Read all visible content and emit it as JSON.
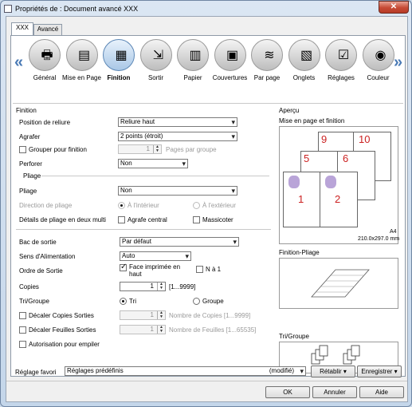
{
  "window": {
    "title": "Propriétés de : Document avancé XXX",
    "close": "✕"
  },
  "tabs": [
    {
      "label": "XXX"
    },
    {
      "label": "Avancé"
    }
  ],
  "categories": [
    {
      "label": "Général",
      "icon": "printer-icon",
      "glyph": "🖶"
    },
    {
      "label": "Mise en Page",
      "icon": "layout-icon",
      "glyph": "▤"
    },
    {
      "label": "Finition",
      "icon": "finishing-icon",
      "glyph": "▦"
    },
    {
      "label": "Sortir",
      "icon": "output-icon",
      "glyph": "⇲"
    },
    {
      "label": "Papier",
      "icon": "paper-icon",
      "glyph": "▥"
    },
    {
      "label": "Couvertures",
      "icon": "cover-icon",
      "glyph": "▣"
    },
    {
      "label": "Par page",
      "icon": "per-page-icon",
      "glyph": "≋"
    },
    {
      "label": "Onglets",
      "icon": "tabs-icon",
      "glyph": "▧"
    },
    {
      "label": "Réglages",
      "icon": "settings-icon",
      "glyph": "☑"
    },
    {
      "label": "Couleur",
      "icon": "color-icon",
      "glyph": "◉"
    }
  ],
  "nav": {
    "left": "«",
    "right": "»"
  },
  "finition": {
    "group_title": "Finition",
    "position_reliure_label": "Position de reliure",
    "position_reliure_value": "Reliure haut",
    "agrafer_label": "Agrafer",
    "agrafer_value": "2 points (étroit)",
    "grouper_label": "Grouper pour finition",
    "grouper_value": "1",
    "pages_par_groupe": "Pages par groupe",
    "perforer_label": "Perforer",
    "perforer_value": "Non"
  },
  "pliage": {
    "group_title": "Pliage",
    "pliage_label": "Pliage",
    "pliage_value": "Non",
    "direction_label": "Direction de pliage",
    "interieur": "À l'intérieur",
    "exterieur": "À l'extérieur",
    "details_label": "Détails de pliage en deux multi",
    "agrafe_centrale": "Agrafe central",
    "massicoter": "Massicoter"
  },
  "sortie": {
    "bac_label": "Bac de sortie",
    "bac_value": "Par défaut",
    "sens_label": "Sens d'Alimentation",
    "sens_value": "Auto",
    "ordre_label": "Ordre de Sortie",
    "face_imprimee": "Face imprimée en haut",
    "n_a_1": "N à 1",
    "copies_label": "Copies",
    "copies_value": "1",
    "copies_range": "[1...9999]",
    "tri_groupe_label": "Tri/Groupe",
    "tri": "Tri",
    "groupe": "Groupe",
    "decaler_copies": "Décaler Copies Sorties",
    "decaler_copies_value": "1",
    "nombre_copies": "Nombre de Copies [1...9999]",
    "decaler_feuilles": "Décaler Feuilles Sorties",
    "decaler_feuilles_value": "1",
    "nombre_feuilles": "Nombre de Feuilles [1...65535]",
    "autorisation": "Autorisation pour empiler"
  },
  "apercu": {
    "title": "Aperçu",
    "mise_en_page": "Mise en page et finition",
    "page_numbers": [
      "9",
      "10",
      "5",
      "6",
      "1",
      "2"
    ],
    "paper_size": "A4",
    "paper_dims": "210.0x297.0 mm",
    "finition_pliage": "Finition-Pliage",
    "tri_groupe": "Tri/Groupe"
  },
  "favori": {
    "label": "Réglage favori",
    "value": "Réglages prédéfinis",
    "modifie": "(modifié)",
    "retablir": "Rétablir",
    "enregistrer": "Enregistrer"
  },
  "buttons": {
    "ok": "OK",
    "annuler": "Annuler",
    "aide": "Aide"
  },
  "colors": {
    "accent": "#4a7ab5",
    "page_number": "#cc2222"
  }
}
